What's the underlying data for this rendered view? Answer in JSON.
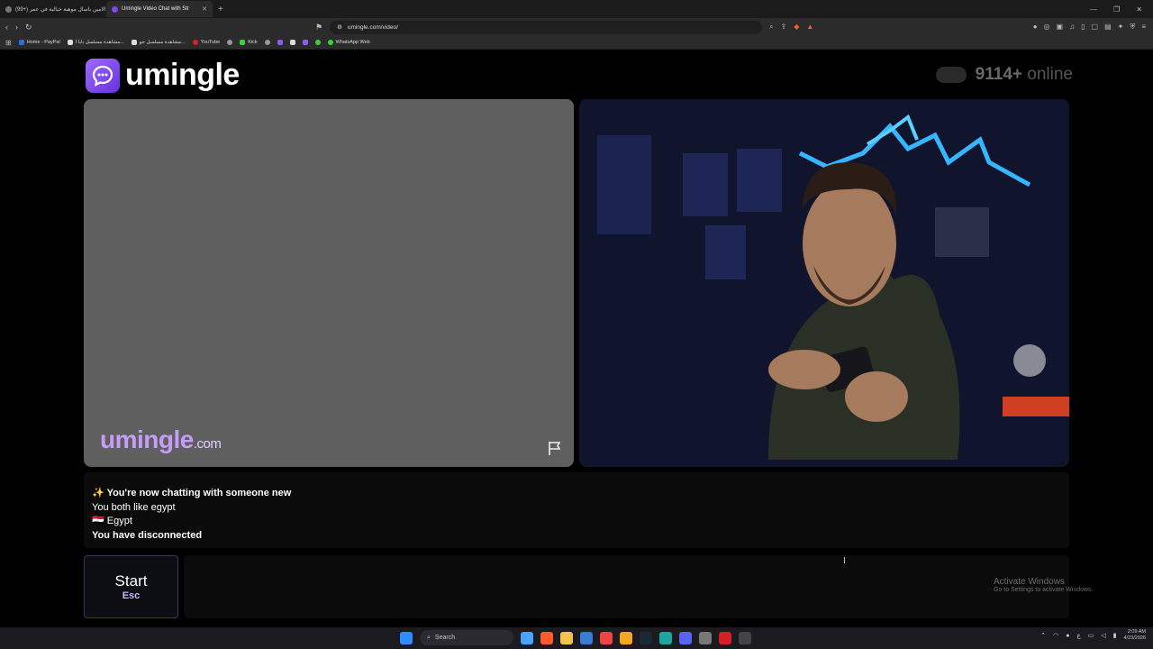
{
  "browser": {
    "tabs": [
      {
        "title": "(99+) الامين ياسال موهبة خيالية في عمر",
        "active": false
      },
      {
        "title": "Umingle Video Chat with Str",
        "active": true
      }
    ],
    "new_tab_icon": "plus-icon",
    "url": "umingle.com/video/",
    "bookmarks": [
      {
        "label": "Home - PayPal",
        "icon": "paypal-icon"
      },
      {
        "label": "مشاهدة مسلسل بابا ا...",
        "icon": "page-icon"
      },
      {
        "label": "مشاهدة مسلسل جو...",
        "icon": "page-icon"
      },
      {
        "label": "YouTube",
        "icon": "youtube-icon"
      },
      {
        "label": "",
        "icon": "circle-icon"
      },
      {
        "label": "Kick",
        "icon": "kick-icon"
      },
      {
        "label": "",
        "icon": "circle-icon"
      },
      {
        "label": "",
        "icon": "app-icon"
      },
      {
        "label": "",
        "icon": "tiktok-icon"
      },
      {
        "label": "",
        "icon": "app-icon"
      },
      {
        "label": "",
        "icon": "spotify-icon"
      },
      {
        "label": "WhatsApp Web",
        "icon": "whatsapp-icon"
      }
    ]
  },
  "site": {
    "logo_text": "umingle",
    "online_count": "9114+",
    "online_label": "online",
    "watermark_main": "umingle",
    "watermark_tld": ".com"
  },
  "chat": {
    "lines": [
      {
        "prefix": "✨ ",
        "text": "You're now chatting with someone new",
        "bold": true
      },
      {
        "prefix": "",
        "text": "You both like egypt",
        "bold": false
      },
      {
        "prefix": "🇪🇬 ",
        "text": "Egypt",
        "bold": false
      },
      {
        "prefix": "",
        "text": "You have disconnected",
        "bold": true
      }
    ]
  },
  "controls": {
    "start_label": "Start",
    "start_key": "Esc"
  },
  "os": {
    "activate_title": "Activate Windows",
    "activate_sub": "Go to Settings to activate Windows.",
    "search_label": "Search",
    "time": "2:09 AM",
    "date": "4/23/2026"
  }
}
